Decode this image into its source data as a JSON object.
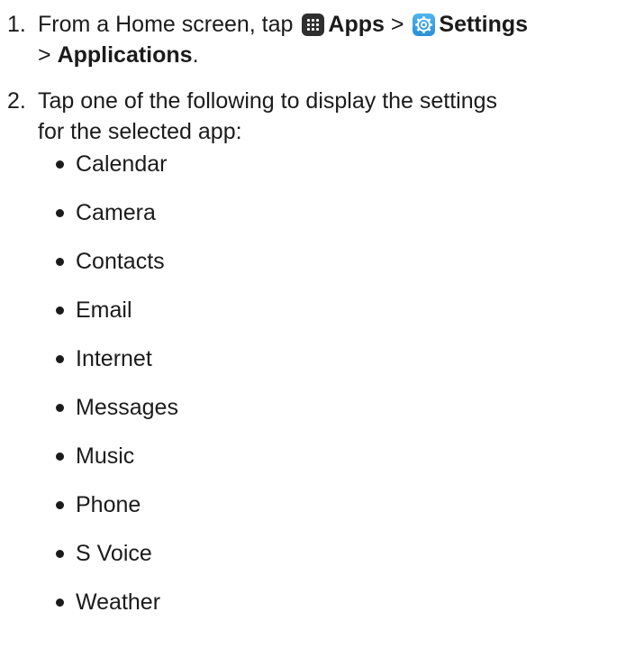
{
  "steps": [
    {
      "number": "1.",
      "text_before": "From a Home screen, tap",
      "apps_label": "Apps",
      "separator_1": ">",
      "settings_label": "Settings",
      "separator_2": ">",
      "applications_label": "Applications",
      "end_punct": "."
    },
    {
      "number": "2.",
      "line1": "Tap one of the following to display the settings",
      "line2": "for the selected app:"
    }
  ],
  "apps_list": [
    "Calendar",
    "Camera",
    "Contacts",
    "Email",
    "Internet",
    "Messages",
    "Music",
    "Phone",
    "S Voice",
    "Weather"
  ],
  "icons": {
    "apps": "apps-grid-icon",
    "settings": "settings-gear-icon"
  },
  "colors": {
    "text": "#1b1b1b",
    "apps_icon_bg": "#2f2f2f",
    "settings_icon_bg": "#2a8fd6"
  }
}
